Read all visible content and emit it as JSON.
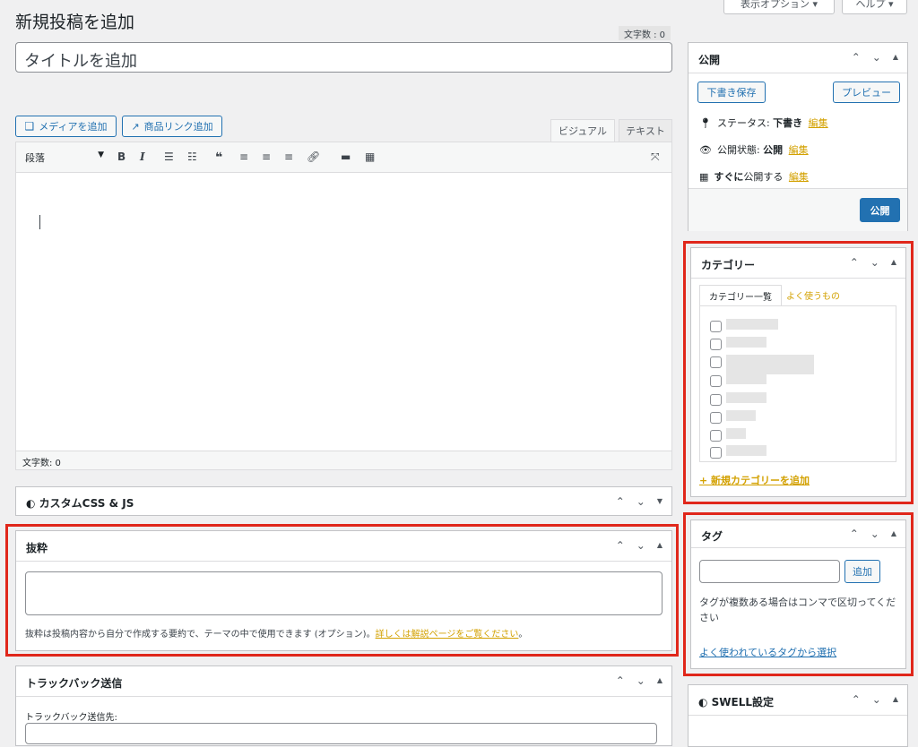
{
  "header": {
    "page_title": "新規投稿を追加",
    "screen_options": "表示オプション ▾",
    "help": "ヘルプ ▾"
  },
  "title": {
    "char_count": "文字数 : 0",
    "placeholder": "タイトルを追加"
  },
  "editor": {
    "add_media": "メディアを追加",
    "product_link": "商品リンク追加",
    "tab_visual": "ビジュアル",
    "tab_text": "テキスト",
    "format_select": "段落",
    "word_count": "文字数: 0"
  },
  "custom_css": {
    "title": "カスタムCSS & JS"
  },
  "excerpt": {
    "title": "抜粋",
    "help_text": "抜粋は投稿内容から自分で作成する要約で、テーマの中で使用できます (オプション)。",
    "help_link": "詳しくは解説ページをご覧ください",
    "help_end": "。"
  },
  "trackback": {
    "title": "トラックバック送信",
    "label": "トラックバック送信先:"
  },
  "publish": {
    "title": "公開",
    "save_draft": "下書き保存",
    "preview": "プレビュー",
    "status_label": "ステータス: ",
    "status_value": "下書き",
    "visibility_label": "公開状態: ",
    "visibility_value": "公開",
    "schedule_value": "すぐに",
    "schedule_label": "公開する",
    "edit": "編集",
    "publish_button": "公開"
  },
  "categories": {
    "title": "カテゴリー",
    "tab_all": "カテゴリー一覧",
    "tab_popular": "よく使うもの",
    "add_new": "+ 新規カテゴリーを追加"
  },
  "tags": {
    "title": "タグ",
    "add_button": "追加",
    "help_text": "タグが複数ある場合はコンマで区切ってください",
    "choose_link": "よく使われているタグから選択"
  },
  "swell": {
    "title": "SWELL設定"
  },
  "colors": {
    "accent": "#2271b1",
    "highlight": "#e0271b",
    "link": "#d3a100"
  }
}
